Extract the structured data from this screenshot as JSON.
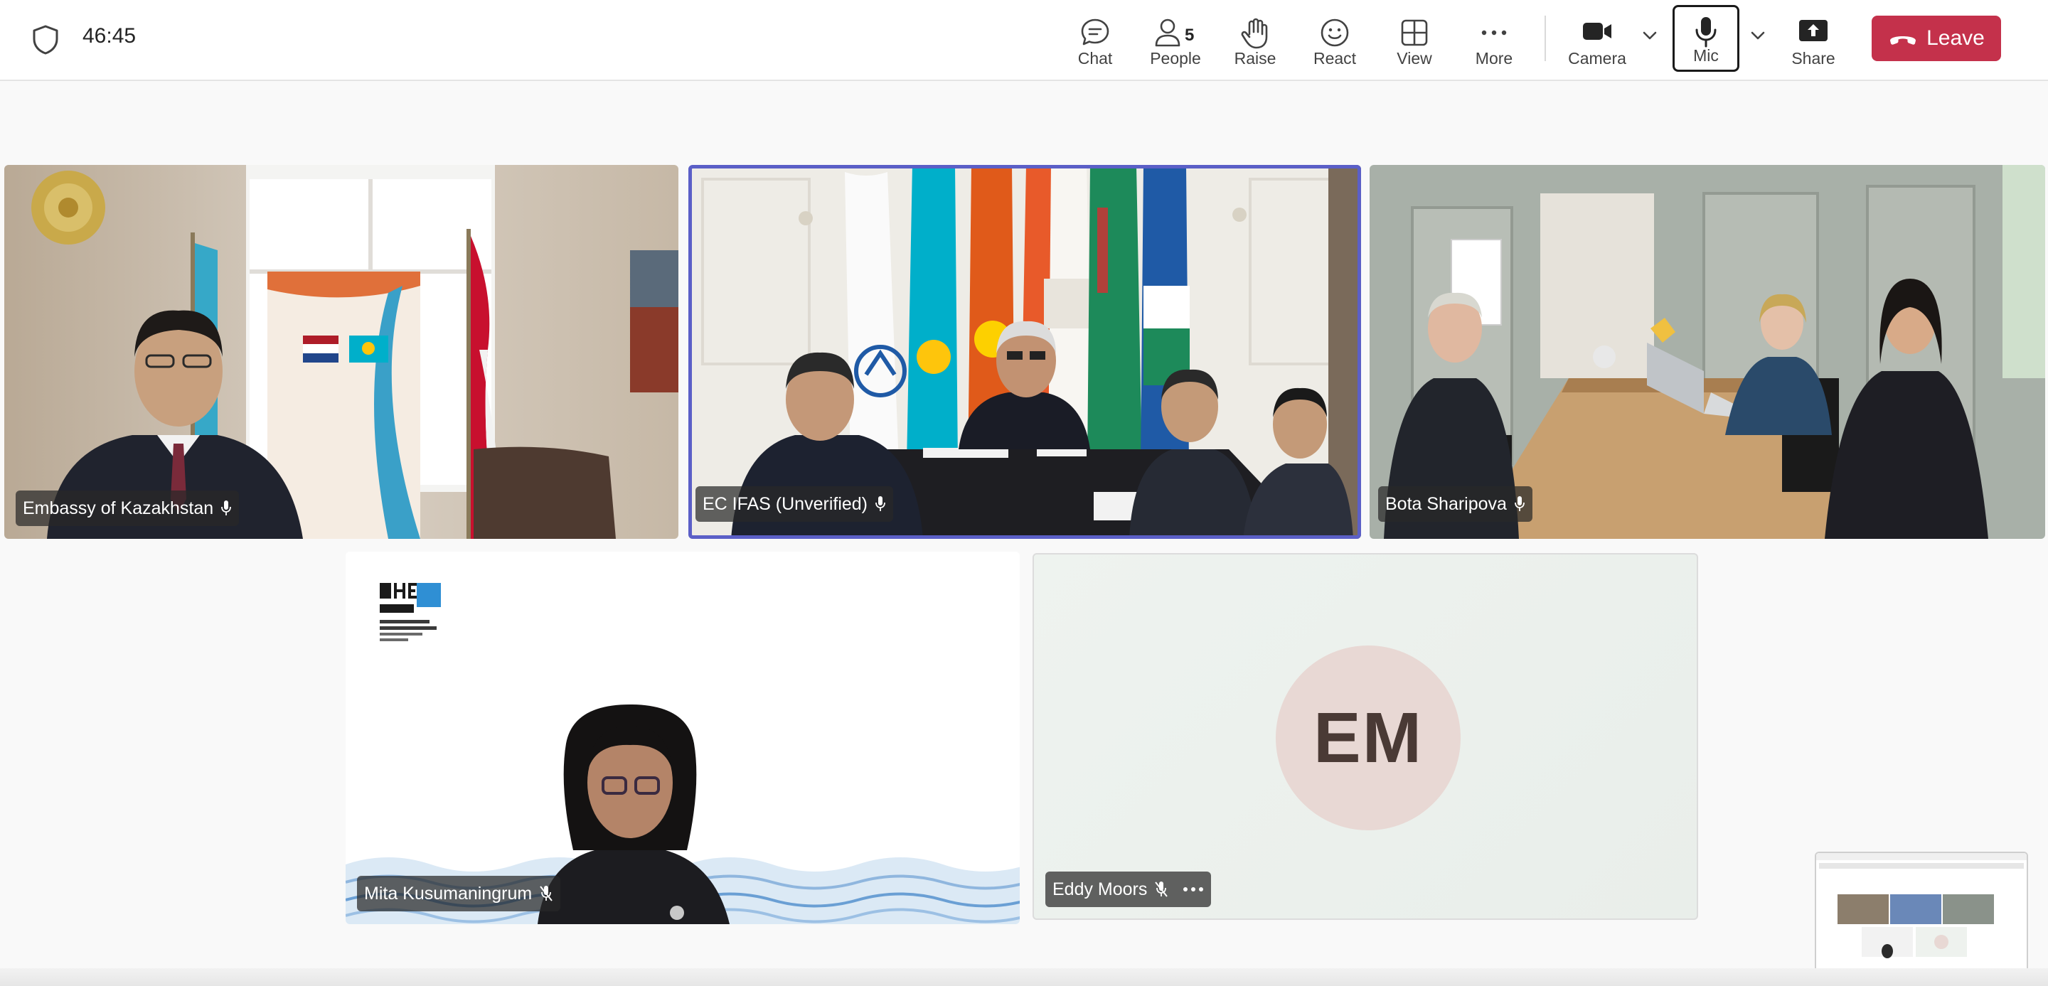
{
  "meeting": {
    "timer": "46:45"
  },
  "toolbar": {
    "chat_label": "Chat",
    "people_label": "People",
    "people_count": "5",
    "raise_label": "Raise",
    "react_label": "React",
    "view_label": "View",
    "more_label": "More",
    "camera_label": "Camera",
    "mic_label": "Mic",
    "share_label": "Share",
    "leave_label": "Leave"
  },
  "participants": [
    {
      "name": "Embassy of Kazakhstan",
      "mic": "on"
    },
    {
      "name": "EC IFAS (Unverified)",
      "mic": "on",
      "speaking": true
    },
    {
      "name": "Bota Sharipova",
      "mic": "on"
    },
    {
      "name": "Mita Kusumaningrum",
      "mic": "muted"
    },
    {
      "name": "Eddy Moors",
      "mic": "muted",
      "initials": "EM"
    }
  ],
  "colors": {
    "leave": "#c4314b",
    "active_speaker": "#5b5fc7",
    "avatar_bg": "#e8d8d4"
  }
}
